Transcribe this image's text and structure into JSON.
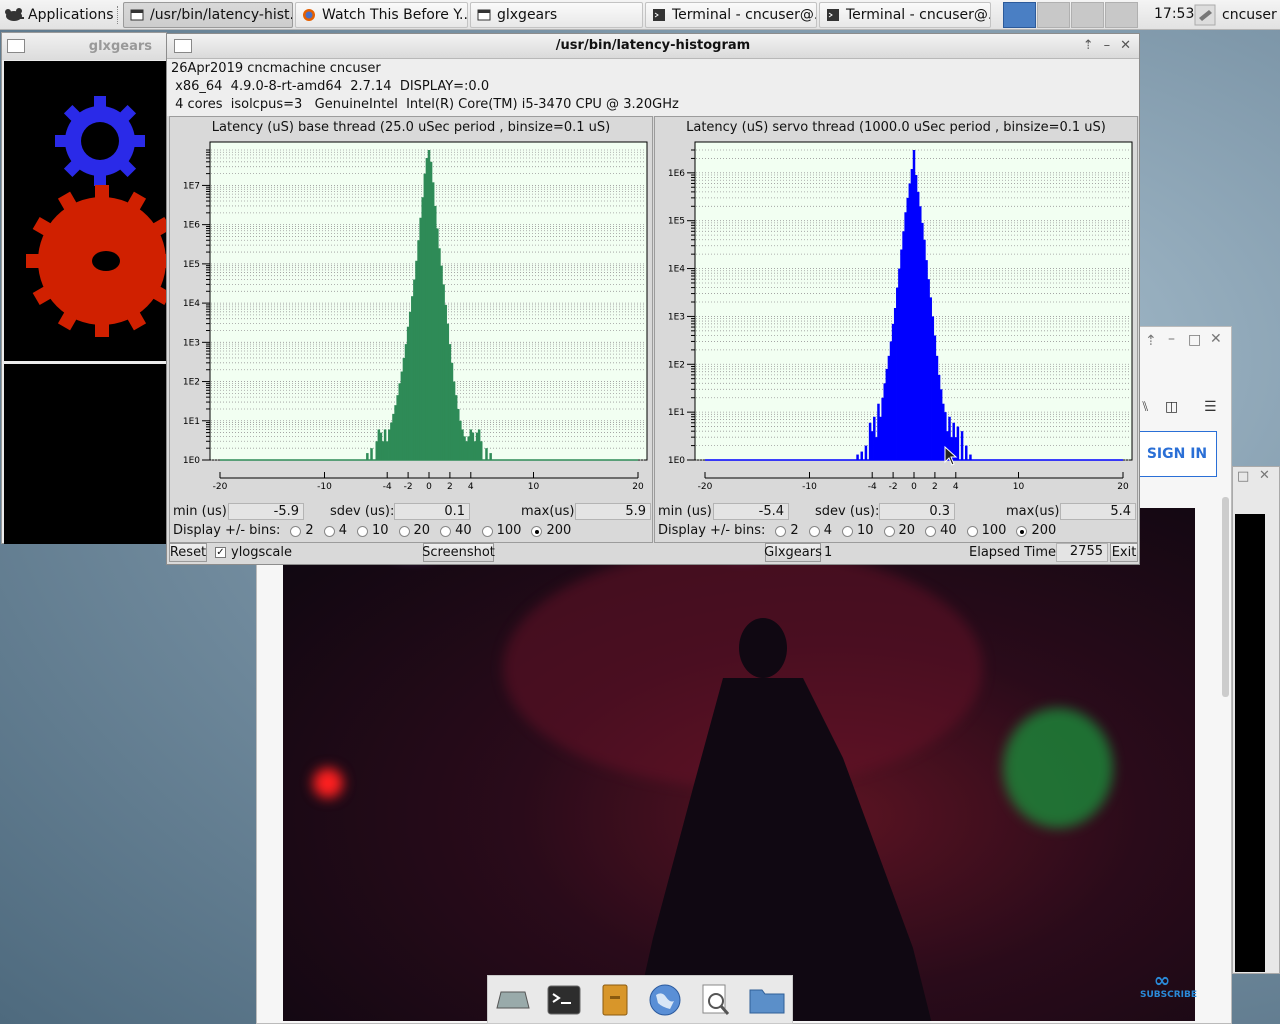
{
  "taskbar": {
    "applications": "Applications",
    "tasks": [
      {
        "label": "/usr/bin/latency-hist...",
        "active": true
      },
      {
        "label": "Watch This Before Y...",
        "active": false
      },
      {
        "label": "glxgears",
        "active": false
      },
      {
        "label": "Terminal - cncuser@...",
        "active": false
      },
      {
        "label": "Terminal - cncuser@...",
        "active": false
      }
    ],
    "clock": "17:53",
    "user": "cncuser"
  },
  "glxgears": {
    "title": "glxgears"
  },
  "browser": {
    "signin": "SIGN IN",
    "subscribe": "SUBSCRIBE"
  },
  "latency": {
    "title": "/usr/bin/latency-histogram",
    "info": [
      "26Apr2019 cncmachine cncuser",
      " x86_64  4.9.0-8-rt-amd64  2.7.14  DISPLAY=:0.0",
      " 4 cores  isolcpus=3   GenuineIntel  Intel(R) Core(TM) i5-3470 CPU @ 3.20GHz"
    ],
    "base": {
      "title": "Latency (uS) base thread (25.0 uSec period , binsize=0.1 uS)",
      "min_label": "min (us)",
      "min": "-5.9",
      "sdev_label": "sdev (us):",
      "sdev": "0.1",
      "max_label": "max(us)",
      "max": "5.9"
    },
    "servo": {
      "title": "Latency (uS) servo thread (1000.0 uSec period , binsize=0.1 uS)",
      "min_label": "min (us)",
      "min": "-5.4",
      "sdev_label": "sdev (us):",
      "sdev": "0.3",
      "max_label": "max(us)",
      "max": "5.4"
    },
    "bins_label": "Display +/- bins:",
    "bins_options": [
      "2",
      "4",
      "10",
      "20",
      "40",
      "100",
      "200"
    ],
    "bins_selected": "200",
    "reset": "Reset",
    "ylogscale": "ylogscale",
    "screenshot": "Screenshot",
    "glxgears_btn": "Glxgears",
    "glxgears_count": "1",
    "elapsed_label": "Elapsed Time:",
    "elapsed": "2755",
    "exit": "Exit"
  },
  "chart_data": [
    {
      "type": "bar",
      "title": "Latency (uS) base thread (25.0 uSec period , binsize=0.1 uS)",
      "color": "#2e8b57",
      "xlim": [
        -20,
        20
      ],
      "xticks": [
        -20,
        -10,
        -4,
        -2,
        0,
        2,
        4,
        10,
        20
      ],
      "ylog": true,
      "ylim": [
        1,
        10000000
      ],
      "yticks": [
        "1E0",
        "1E1",
        "1E2",
        "1E3",
        "1E4",
        "1E5",
        "1E6",
        "1E7"
      ],
      "peak": 80000000,
      "x": [
        -5.9,
        -5.5,
        -5.0,
        -4.8,
        -4.6,
        -4.4,
        -4.2,
        -4.0,
        -3.8,
        -3.6,
        -3.4,
        -3.2,
        -3.0,
        -2.8,
        -2.6,
        -2.4,
        -2.2,
        -2.0,
        -1.8,
        -1.6,
        -1.4,
        -1.2,
        -1.0,
        -0.8,
        -0.6,
        -0.4,
        -0.2,
        0.0,
        0.2,
        0.4,
        0.6,
        0.8,
        1.0,
        1.2,
        1.4,
        1.6,
        1.8,
        2.0,
        2.2,
        2.4,
        2.6,
        2.8,
        3.0,
        3.2,
        3.4,
        3.6,
        3.8,
        4.0,
        4.2,
        4.4,
        4.6,
        4.8,
        5.0,
        5.5,
        5.9
      ],
      "values": [
        1.5,
        2,
        3,
        6,
        5,
        3,
        6,
        3,
        6,
        9,
        15,
        25,
        45,
        90,
        180,
        400,
        900,
        2500,
        6000,
        15000,
        40000,
        120000,
        400000,
        1500000,
        5000000,
        20000000,
        50000000,
        80000000,
        40000000,
        12000000,
        3000000,
        800000,
        250000,
        90000,
        30000,
        9000,
        3000,
        900,
        300,
        100,
        45,
        20,
        10,
        6,
        4,
        3,
        4,
        6,
        5,
        3,
        5,
        6,
        3,
        2,
        1.5
      ]
    },
    {
      "type": "bar",
      "title": "Latency (uS) servo thread (1000.0 uSec period , binsize=0.1 uS)",
      "color": "#0000ff",
      "xlim": [
        -20,
        20
      ],
      "xticks": [
        -20,
        -10,
        -4,
        -2,
        0,
        2,
        4,
        10,
        20
      ],
      "ylog": true,
      "ylim": [
        1,
        1000000
      ],
      "yticks": [
        "1E0",
        "1E1",
        "1E2",
        "1E3",
        "1E4",
        "1E5",
        "1E6"
      ],
      "peak": 3000000,
      "x": [
        -5.4,
        -5.0,
        -4.6,
        -4.2,
        -4.0,
        -3.8,
        -3.6,
        -3.4,
        -3.2,
        -3.0,
        -2.8,
        -2.6,
        -2.4,
        -2.2,
        -2.0,
        -1.8,
        -1.6,
        -1.4,
        -1.2,
        -1.0,
        -0.8,
        -0.6,
        -0.4,
        -0.2,
        0.0,
        0.2,
        0.4,
        0.6,
        0.8,
        1.0,
        1.2,
        1.4,
        1.6,
        1.8,
        2.0,
        2.2,
        2.4,
        2.6,
        2.8,
        3.0,
        3.2,
        3.4,
        3.6,
        3.8,
        4.0,
        4.2,
        4.6,
        5.0,
        5.4
      ],
      "values": [
        1.3,
        1.5,
        2,
        6,
        4,
        8,
        3,
        15,
        8,
        20,
        40,
        80,
        150,
        300,
        700,
        1500,
        4000,
        10000,
        25000,
        60000,
        150000,
        300000,
        600000,
        1200000,
        3000000,
        900000,
        400000,
        200000,
        90000,
        40000,
        15000,
        6000,
        2500,
        1000,
        400,
        150,
        60,
        30,
        15,
        10,
        4,
        8,
        3,
        6,
        3,
        5,
        4,
        2,
        1.3
      ]
    }
  ]
}
